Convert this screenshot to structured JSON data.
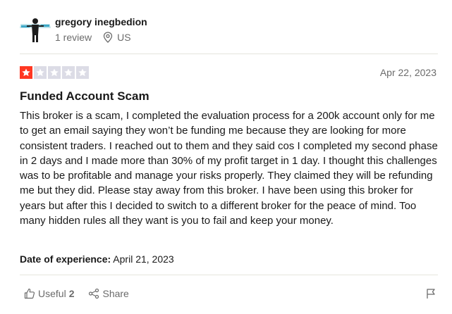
{
  "reviewer": {
    "name": "gregory inegbedion",
    "review_count": "1 review",
    "location": "US"
  },
  "review": {
    "rating": 1,
    "max_rating": 5,
    "date": "Apr 22, 2023",
    "title": "Funded Account Scam",
    "body": "This broker is a scam, I completed the evaluation process for a 200k account only for me to get an email saying they won’t be funding me because they are looking for more consistent traders. I reached out to them and they said cos I completed my second phase in 2 days and I made more than 30% of my profit target in 1 day. I thought this challenges was to be profitable and manage your risks properly. They claimed they will be refunding me but they did. Please stay away from this broker. I have been using this broker for years but after this I decided to switch to a different broker for the peace of mind. Too many hidden rules all they want is you to fail and keep your money.",
    "experience_label": "Date of experience:",
    "experience_date": "April 21, 2023"
  },
  "actions": {
    "useful_label": "Useful",
    "useful_count": "2",
    "share_label": "Share"
  },
  "icons": {
    "location": "location-pin-icon",
    "useful": "thumbs-up-icon",
    "share": "share-icon",
    "flag": "flag-icon",
    "star": "star-icon"
  },
  "colors": {
    "star_filled": "#ff3722",
    "star_empty": "#dcdce6",
    "muted_text": "#6b6b6b",
    "divider": "#e5e5dd"
  }
}
